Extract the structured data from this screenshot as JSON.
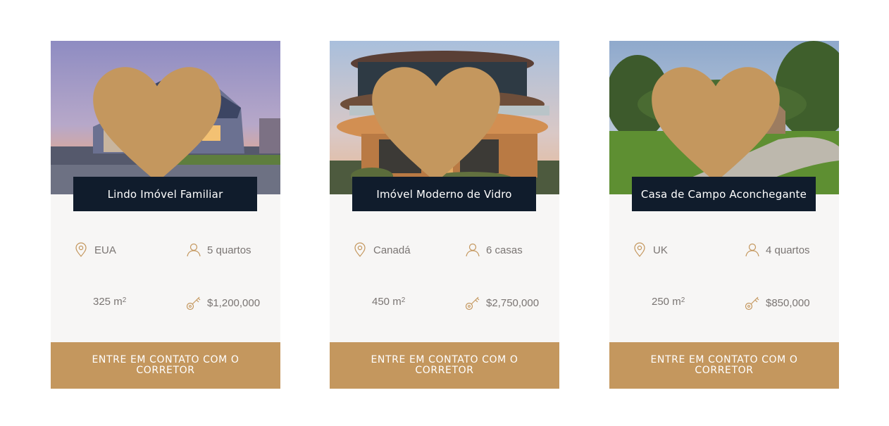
{
  "colors": {
    "title_bg": "#101c2c",
    "accent": "#c4975e",
    "card_bg": "#f7f6f5",
    "text_muted": "#7a7573"
  },
  "icons": {
    "favorite": "heart-icon",
    "location": "map-pin-icon",
    "rooms": "user-icon",
    "price": "key-icon"
  },
  "cards": [
    {
      "title": "Lindo Imóvel Familiar",
      "location": "EUA",
      "rooms": "5 quartos",
      "area_value": "325 m",
      "area_unit_exp": "2",
      "price": "$1,200,000",
      "cta": "ENTRE EM CONTATO COM O CORRETOR"
    },
    {
      "title": "Imóvel Moderno de Vidro",
      "location": "Canadá",
      "rooms": "6 casas",
      "area_value": "450 m",
      "area_unit_exp": "2",
      "price": "$2,750,000",
      "cta": "ENTRE EM CONTATO COM O CORRETOR"
    },
    {
      "title": "Casa de Campo Aconchegante",
      "location": "UK",
      "rooms": "4 quartos",
      "area_value": "250 m",
      "area_unit_exp": "2",
      "price": "$850,000",
      "cta": "ENTRE EM CONTATO COM O CORRETOR"
    }
  ]
}
